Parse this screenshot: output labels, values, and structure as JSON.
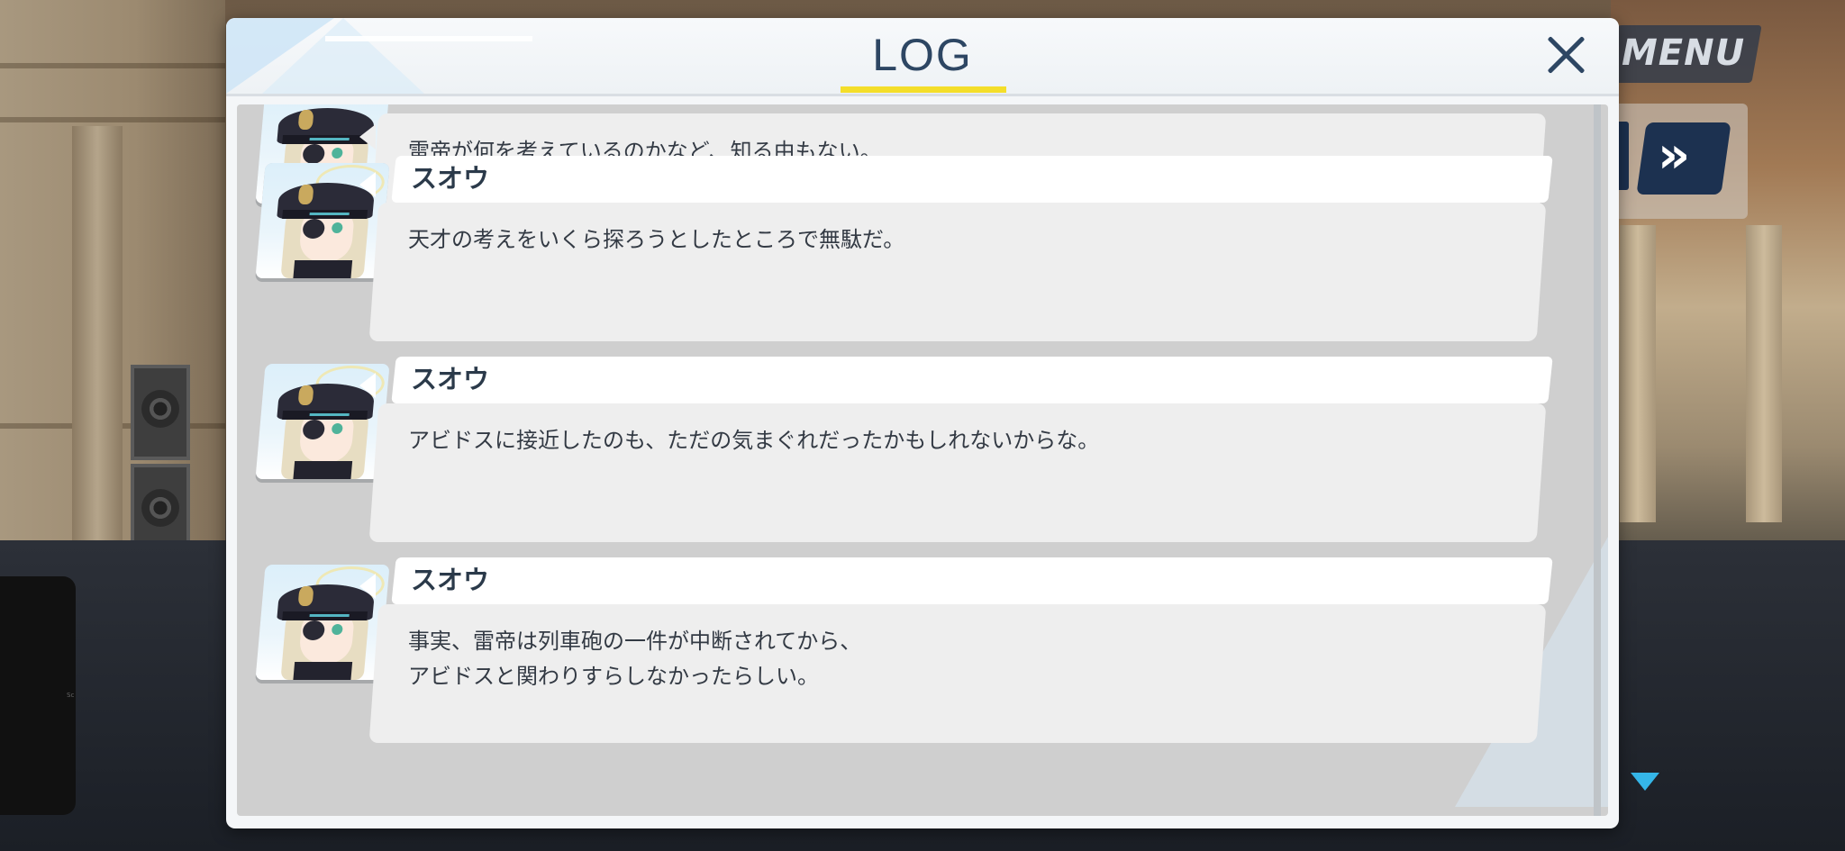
{
  "hud": {
    "menu_label": "MENU",
    "fast_forward_glyph": "»",
    "fast_forward_icon": "fast-forward-icon",
    "next_icon": "next-arrow-icon"
  },
  "log": {
    "title": "LOG",
    "close_icon": "close-icon",
    "accent_color": "#f4de2a",
    "title_color": "#2d4663",
    "entries": [
      {
        "speaker": "",
        "lines": [
          "雷帝が何を考えているのかなど、知る由もない。",
          ""
        ]
      },
      {
        "speaker": "スオウ",
        "lines": [
          "天才の考えをいくら探ろうとしたところで無駄だ。",
          ""
        ]
      },
      {
        "speaker": "スオウ",
        "lines": [
          "アビドスに接近したのも、ただの気まぐれだったかもしれないからな。",
          ""
        ]
      },
      {
        "speaker": "スオウ",
        "lines": [
          "事実、雷帝は列車砲の一件が中断されてから、",
          "アビドスと関わりすらしなかったらしい。"
        ]
      }
    ]
  }
}
